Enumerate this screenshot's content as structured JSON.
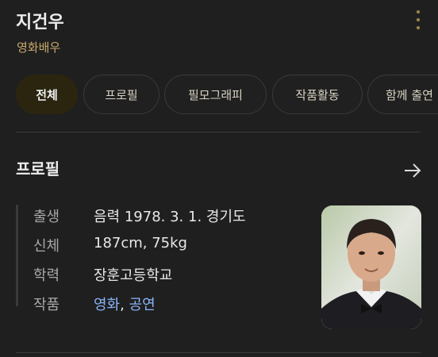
{
  "header": {
    "name": "지건우",
    "subtitle": "영화배우"
  },
  "tabs": [
    {
      "label": "전체",
      "active": true
    },
    {
      "label": "프로필",
      "active": false
    },
    {
      "label": "필모그래피",
      "active": false
    },
    {
      "label": "작품활동",
      "active": false
    },
    {
      "label": "함께 출연",
      "active": false
    }
  ],
  "profile": {
    "title": "프로필",
    "rows": [
      {
        "label": "출생",
        "value": "음력 1978. 3. 1. 경기도"
      },
      {
        "label": "신체",
        "value": "187cm, 75kg"
      },
      {
        "label": "학력",
        "value": "장훈고등학교"
      },
      {
        "label": "작품",
        "value_parts": [
          "영화",
          ", ",
          "공연"
        ]
      }
    ]
  },
  "icons": {
    "more": "more-vert-icon",
    "arrow": "arrow-right-icon"
  },
  "colors": {
    "accent": "#c8a86a",
    "link": "#8ab4f8",
    "active_chip": "#2b2510",
    "background": "#1f1f1f"
  }
}
